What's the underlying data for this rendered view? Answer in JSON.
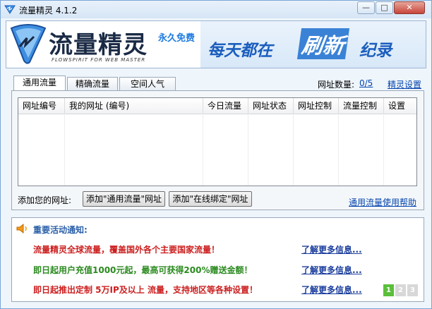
{
  "window": {
    "title": "流量精灵 4.1.2",
    "controls": {
      "minimize": "—",
      "maximize": "□",
      "close": "✕"
    }
  },
  "banner": {
    "logo_text": "流量精灵",
    "logo_sub": "FLOWSPIRIT FOR WEB MASTER",
    "forever_free": "永久免费",
    "slogan_1": "每天都在",
    "slogan_2": "刷新",
    "slogan_3": "纪录",
    "colors": {
      "brand_blue": "#1b5ebd",
      "accent_blue": "#3a82d6"
    }
  },
  "tabs": [
    {
      "label": "通用流量",
      "active": true
    },
    {
      "label": "精确流量",
      "active": false
    },
    {
      "label": "空间人气",
      "active": false
    }
  ],
  "url_count": {
    "label": "网址数量:",
    "value": "0/5"
  },
  "settings_link": "精灵设置",
  "table": {
    "columns": [
      "网址编号",
      "我的网址 (编号)",
      "今日流量",
      "网址状态",
      "网址控制",
      "流量控制",
      "设置"
    ],
    "rows": []
  },
  "add_url": {
    "label": "添加您的网址:",
    "btn_general": "添加\"通用流量\"网址",
    "btn_bind": "添加\"在线绑定\"网址"
  },
  "help_link": "通用流量使用帮助",
  "notice": {
    "title": "重要活动通知:",
    "items": [
      {
        "text": "流量精灵全球流量，覆盖国外各个主要国家流量！",
        "more": "了解更多信息...",
        "color": "#cc1f1f"
      },
      {
        "text": "即日起用户充值1000元起，最高可获得200%赠送金额！",
        "more": "了解更多信息...",
        "color": "#2a8a1e"
      },
      {
        "text": "即日起推出定制  5万IP及以上  流量，支持地区等各种设置！",
        "more": "了解更多信息...",
        "color": "#cc1f1f"
      }
    ],
    "pages": [
      "1",
      "2",
      "3"
    ],
    "current_page": "1"
  }
}
